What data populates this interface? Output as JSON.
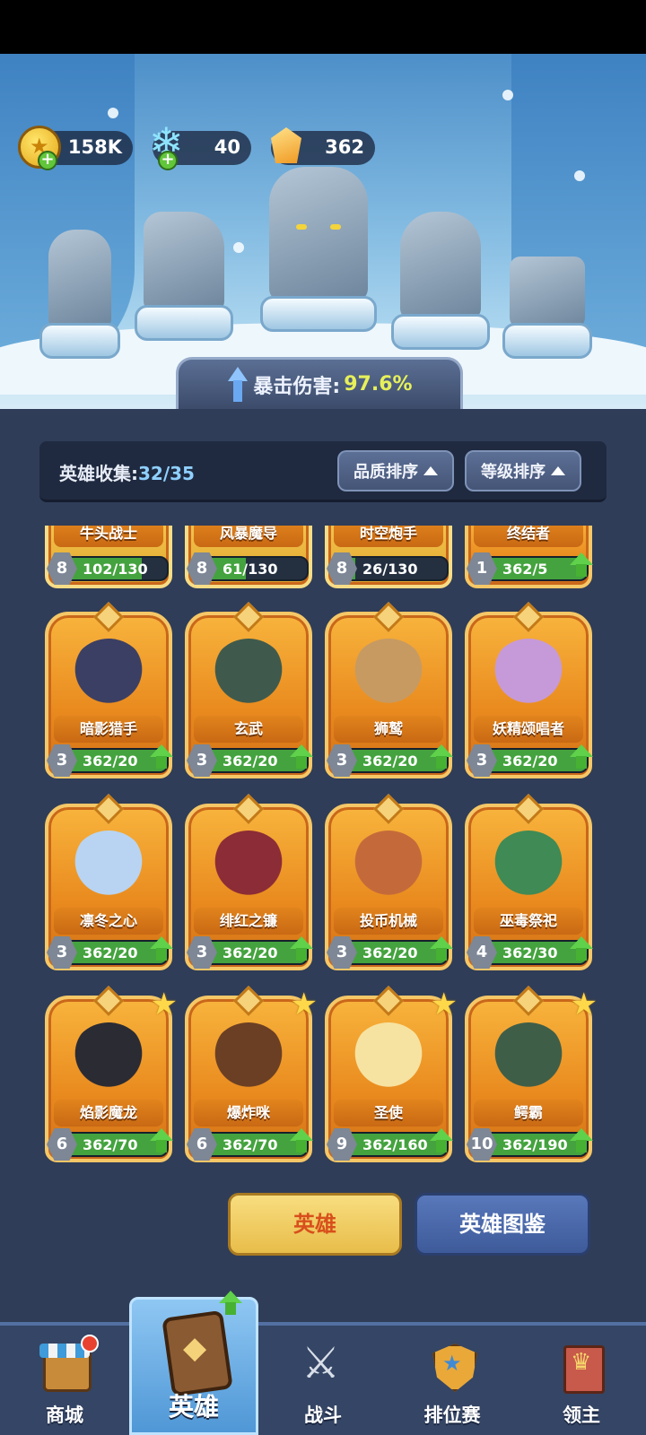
{
  "currency": {
    "gold": "158K",
    "crystal": "40",
    "gem": "362"
  },
  "crit": {
    "label": "暴击伤害:",
    "value": "97.6%"
  },
  "collection": {
    "label": "英雄收集:",
    "count": "32/35",
    "sort_quality": "品质排序",
    "sort_level": "等级排序"
  },
  "heroes_partial": [
    {
      "name": "牛头战士",
      "level": "8",
      "progress": "102/130",
      "progress_ratio": 0.78,
      "upgradable": false
    },
    {
      "name": "风暴魔导",
      "level": "8",
      "progress": "61/130",
      "progress_ratio": 0.47,
      "upgradable": false
    },
    {
      "name": "时空炮手",
      "level": "8",
      "progress": "26/130",
      "progress_ratio": 0.2,
      "upgradable": false
    },
    {
      "name": "终结者",
      "level": "1",
      "progress": "362/5",
      "progress_ratio": 1.0,
      "upgradable": true
    }
  ],
  "heroes": [
    {
      "name": "暗影猎手",
      "level": "3",
      "progress": "362/20",
      "progress_ratio": 1.0,
      "upgradable": true,
      "starred": false,
      "color": "#3b3f63"
    },
    {
      "name": "玄武",
      "level": "3",
      "progress": "362/20",
      "progress_ratio": 1.0,
      "upgradable": true,
      "starred": false,
      "color": "#3f5a4c"
    },
    {
      "name": "狮鹫",
      "level": "3",
      "progress": "362/20",
      "progress_ratio": 1.0,
      "upgradable": true,
      "starred": false,
      "color": "#c79a62"
    },
    {
      "name": "妖精颂唱者",
      "level": "3",
      "progress": "362/20",
      "progress_ratio": 1.0,
      "upgradable": true,
      "starred": false,
      "color": "#c69ad8"
    },
    {
      "name": "凛冬之心",
      "level": "3",
      "progress": "362/20",
      "progress_ratio": 1.0,
      "upgradable": true,
      "starred": false,
      "color": "#b8d4f2"
    },
    {
      "name": "绯红之镰",
      "level": "3",
      "progress": "362/20",
      "progress_ratio": 1.0,
      "upgradable": true,
      "starred": false,
      "color": "#8c2c36"
    },
    {
      "name": "投币机械",
      "level": "3",
      "progress": "362/20",
      "progress_ratio": 1.0,
      "upgradable": true,
      "starred": false,
      "color": "#c46a3a"
    },
    {
      "name": "巫毒祭祀",
      "level": "4",
      "progress": "362/30",
      "progress_ratio": 1.0,
      "upgradable": true,
      "starred": false,
      "color": "#3f8a55"
    },
    {
      "name": "焰影魔龙",
      "level": "6",
      "progress": "362/70",
      "progress_ratio": 1.0,
      "upgradable": true,
      "starred": true,
      "color": "#2b2b33"
    },
    {
      "name": "爆炸咪",
      "level": "6",
      "progress": "362/70",
      "progress_ratio": 1.0,
      "upgradable": true,
      "starred": true,
      "color": "#6b3f24"
    },
    {
      "name": "圣使",
      "level": "9",
      "progress": "362/160",
      "progress_ratio": 1.0,
      "upgradable": true,
      "starred": true,
      "color": "#f6e3a2"
    },
    {
      "name": "鳄霸",
      "level": "10",
      "progress": "362/190",
      "progress_ratio": 1.0,
      "upgradable": true,
      "starred": true,
      "color": "#3f5e48"
    }
  ],
  "buttons": {
    "hero": "英雄",
    "codex": "英雄图鉴"
  },
  "nav": {
    "shop": "商城",
    "hero": "英雄",
    "battle": "战斗",
    "ranked": "排位赛",
    "lord": "领主"
  }
}
